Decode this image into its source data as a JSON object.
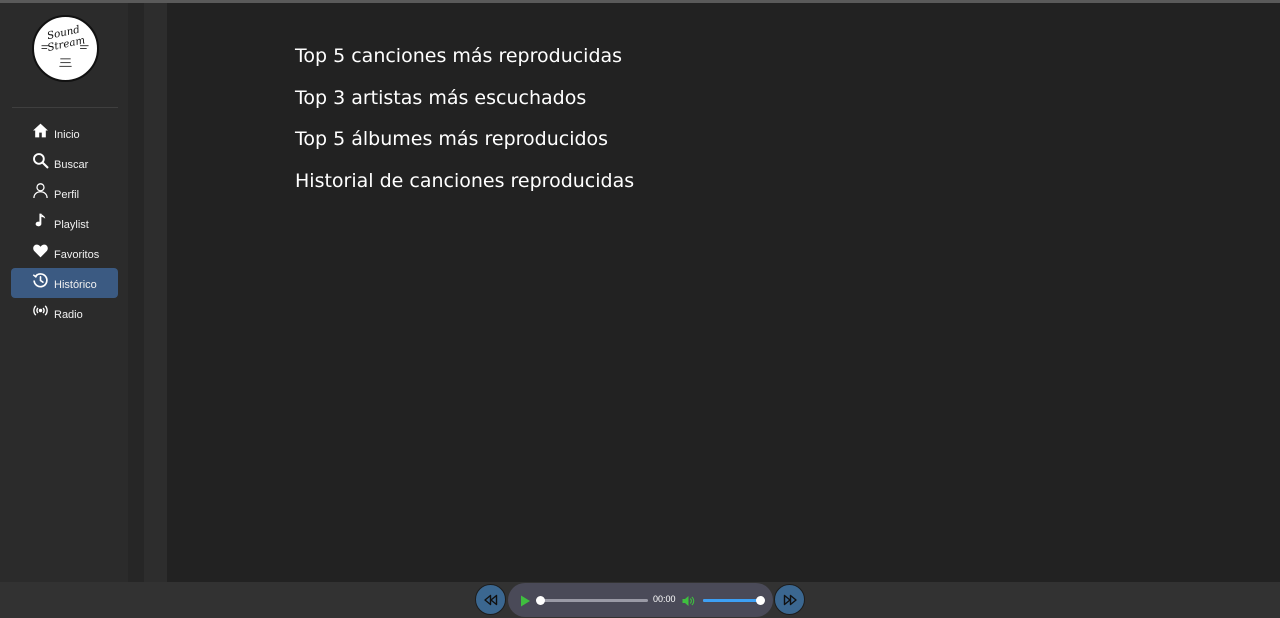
{
  "logo": {
    "line1": "Sound",
    "line2": "Stream"
  },
  "nav": {
    "items": [
      {
        "label": "Inicio",
        "icon": "home-icon",
        "active": false
      },
      {
        "label": "Buscar",
        "icon": "search-icon",
        "active": false
      },
      {
        "label": "Perfil",
        "icon": "user-icon",
        "active": false
      },
      {
        "label": "Playlist",
        "icon": "music-note-icon",
        "active": false
      },
      {
        "label": "Favoritos",
        "icon": "heart-icon",
        "active": false
      },
      {
        "label": "Histórico",
        "icon": "history-icon",
        "active": true
      },
      {
        "label": "Radio",
        "icon": "radio-broadcast-icon",
        "active": false
      }
    ]
  },
  "main": {
    "links": [
      "Top 5 canciones más reproducidas",
      "Top 3 artistas más escuchados",
      "Top 5 álbumes más reproducidos",
      "Historial de canciones reproducidas"
    ]
  },
  "player": {
    "time": "00:00",
    "progress": 0,
    "volume": 1,
    "colors": {
      "accent": "#3b6790",
      "play": "#3fbf3f",
      "volume_fill": "#3da0f5",
      "active_nav": "#3b5a82"
    }
  }
}
